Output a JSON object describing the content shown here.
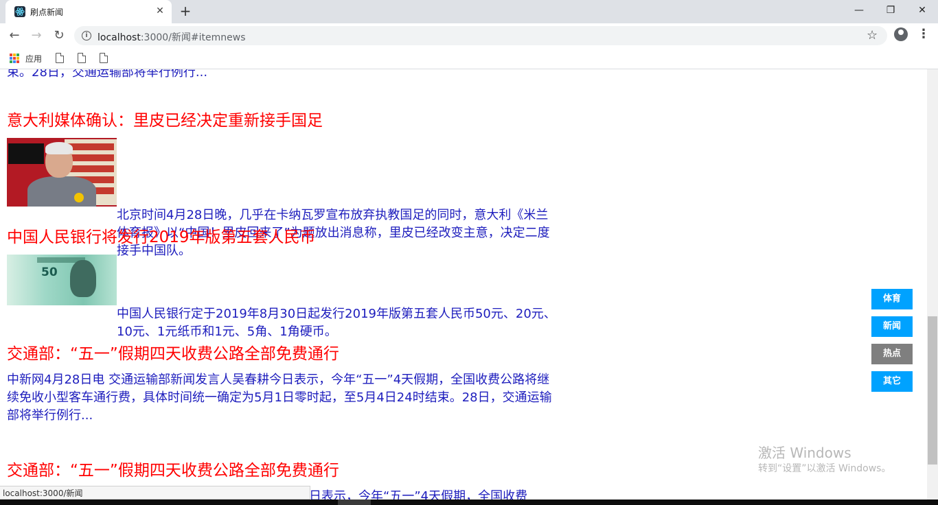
{
  "browser": {
    "tab_title": "刷点新闻",
    "tab_close": "✕",
    "new_tab": "+",
    "window_controls": {
      "minimize": "—",
      "maximize": "❐",
      "close": "✕"
    },
    "nav": {
      "back": "←",
      "forward": "→",
      "reload": "↻"
    },
    "url_host": "localhost",
    "url_rest": ":3000/新闻#itemnews",
    "bookmarks": {
      "apps_label": "应用",
      "file_count": 3
    },
    "icons": [
      "info-icon",
      "star-icon",
      "profile-icon",
      "menu-icon",
      "apps-icon",
      "file-icon"
    ]
  },
  "news": [
    {
      "text": "束。28日，交通运输部将举行例行..."
    },
    {
      "title": "意大利媒体确认：里皮已经决定重新接手国足",
      "text": "北京时间4月28日晚，几乎在卡纳瓦罗宣布放弃执教国足的同时，意大利《米兰体育报》以“中国！里皮回来了”为题放出消息称，里皮已经改变主意，决定二度接手中国队。",
      "thumb": "lippi-photo"
    },
    {
      "title": "中国人民银行将发行2019年版第五套人民币",
      "text": "中国人民银行定于2019年8月30日起发行2019年版第五套人民币50元、20元、10元、1元纸币和1元、5角、1角硬币。",
      "thumb": "banknote-photo"
    },
    {
      "title": "交通部：“五一”假期四天收费公路全部免费通行",
      "text": "中新网4月28日电 交通运输部新闻发言人吴春耕今日表示，今年“五一”4天假期，全国收费公路将继续免收小型客车通行费，具体时间统一确定为5月1日零时起，至5月4日24时结束。28日，交通运输部将举行例行..."
    },
    {
      "title": "交通部：“五一”假期四天收费公路全部免费通行",
      "text": "日表示，今年“五一”4天假期，全国收费"
    }
  ],
  "side_nav": [
    {
      "label": "体育",
      "color": "#00a2ff"
    },
    {
      "label": "新闻",
      "color": "#00a2ff"
    },
    {
      "label": "热点",
      "color": "#7f7f7f"
    },
    {
      "label": "其它",
      "color": "#00a2ff"
    }
  ],
  "watermark": {
    "title": "激活 Windows",
    "subtitle": "转到“设置”以激活 Windows。"
  },
  "status_bar": {
    "url": "localhost:3000/新闻"
  },
  "colors": {
    "title_red": "#ff0000",
    "text_blue": "#1d1dbd",
    "button_blue": "#00a2ff",
    "button_gray": "#7f7f7f"
  }
}
